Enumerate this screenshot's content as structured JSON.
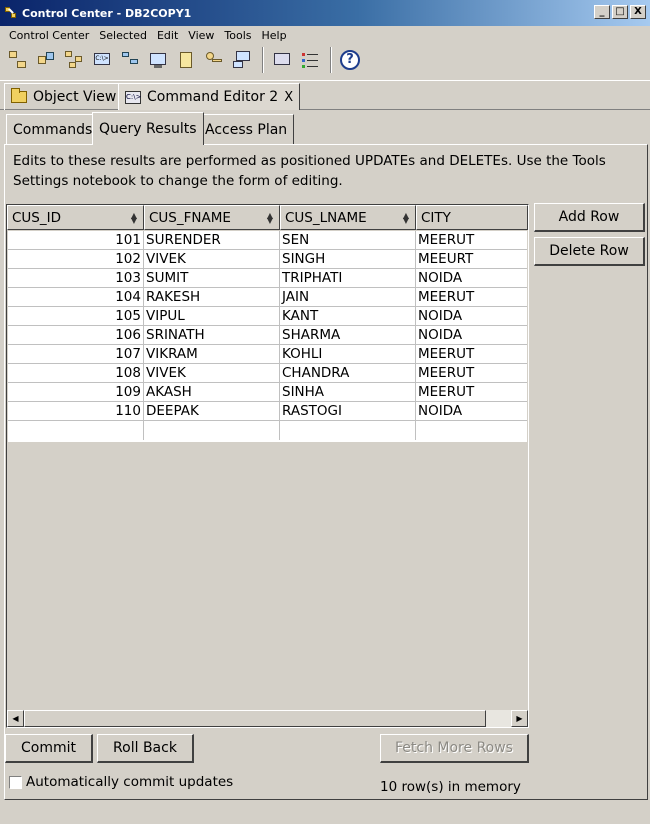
{
  "window": {
    "title": "Control Center - DB2COPY1",
    "min_glyph": "_",
    "max_glyph": "□",
    "close_glyph": "X"
  },
  "menu": [
    "Control Center",
    "Selected",
    "Edit",
    "View",
    "Tools",
    "Help"
  ],
  "toolbar": {
    "icons": [
      "object-tree-icon",
      "refresh-tree-icon",
      "tree-nodes-icon",
      "command-editor-icon",
      "hierarchy-icon",
      "monitor-icon",
      "journal-icon",
      "key-icon",
      "network-icon",
      "tasks-icon",
      "list-icon",
      "help-icon"
    ],
    "help_glyph": "?",
    "cmd_glyph": "C:\\>"
  },
  "view_tabs": [
    {
      "label": "Object View"
    },
    {
      "label": "Command Editor 2",
      "close": "X"
    }
  ],
  "sub_tabs": [
    "Commands",
    "Query Results",
    "Access Plan"
  ],
  "note": "Edits to these results are performed as positioned UPDATEs and DELETEs.  Use the Tools Settings notebook to change the form of editing.",
  "table": {
    "columns": [
      "CUS_ID",
      "CUS_FNAME",
      "CUS_LNAME",
      "CITY"
    ],
    "rows": [
      [
        "101",
        "SURENDER",
        "SEN",
        "MEERUT"
      ],
      [
        "102",
        "VIVEK",
        "SINGH",
        "MEEURT"
      ],
      [
        "103",
        "SUMIT",
        "TRIPHATI",
        "NOIDA"
      ],
      [
        "104",
        "RAKESH",
        "JAIN",
        "MEERUT"
      ],
      [
        "105",
        "VIPUL",
        "KANT",
        "NOIDA"
      ],
      [
        "106",
        "SRINATH",
        "SHARMA",
        "NOIDA"
      ],
      [
        "107",
        "VIKRAM",
        "KOHLI",
        "MEERUT"
      ],
      [
        "108",
        "VIVEK",
        "CHANDRA",
        "MEERUT"
      ],
      [
        "109",
        "AKASH",
        "SINHA",
        "MEERUT"
      ],
      [
        "110",
        "DEEPAK",
        "RASTOGI",
        "NOIDA"
      ]
    ]
  },
  "side_buttons": {
    "add_row": "Add Row",
    "delete_row": "Delete Row"
  },
  "bottom_buttons": {
    "commit": "Commit",
    "rollback": "Roll Back",
    "fetch_more": "Fetch More Rows"
  },
  "auto_commit_label": "Automatically commit updates",
  "status": "10 row(s) in memory"
}
